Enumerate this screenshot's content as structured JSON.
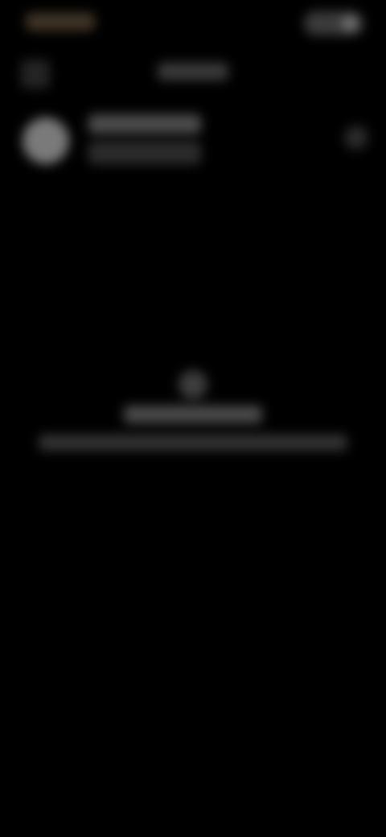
{
  "screen": {
    "background": "#000000",
    "obscured": true
  },
  "status_bar": {
    "time": "",
    "icons": [
      "battery-icon"
    ]
  },
  "header": {
    "title": "",
    "back_icon": "back-arrow-icon"
  },
  "profile": {
    "name": "",
    "subtitle": "",
    "more_icon": "more-vertical-icon"
  },
  "empty_state": {
    "icon": "info-icon",
    "title": "",
    "description": ""
  }
}
